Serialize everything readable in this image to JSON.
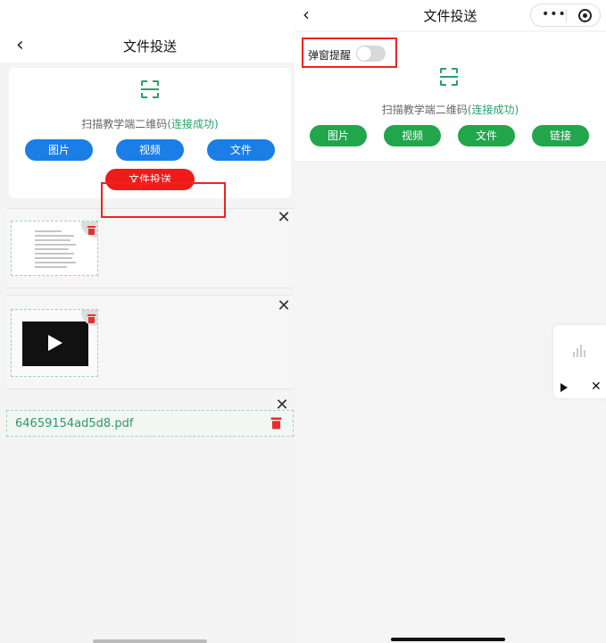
{
  "left": {
    "title": "文件投送",
    "back_icon": "‹",
    "scan_prefix": "扫描教学端二维码",
    "scan_status": "(连接成功)",
    "buttons": {
      "image": "图片",
      "video": "视频",
      "file": "文件"
    },
    "cast_button": "文件投送",
    "close_symbol": "✕",
    "pdf_filename": "64659154ad5d8.pdf",
    "colors": {
      "accent_blue": "#1a7ee6",
      "cast_red": "#ef1b1b",
      "success_green": "#29a06a"
    }
  },
  "right": {
    "title": "文件投送",
    "back_icon": "‹",
    "capsule_more": "•••",
    "popup_toggle_label": "弹窗提醒",
    "popup_toggle_on": false,
    "scan_prefix": "扫描教学端二维码",
    "scan_status": "(连接成功)",
    "buttons": {
      "image": "图片",
      "video": "视频",
      "file": "文件",
      "link": "链接"
    },
    "player_close": "✕",
    "colors": {
      "button_green": "#21a64c"
    }
  }
}
